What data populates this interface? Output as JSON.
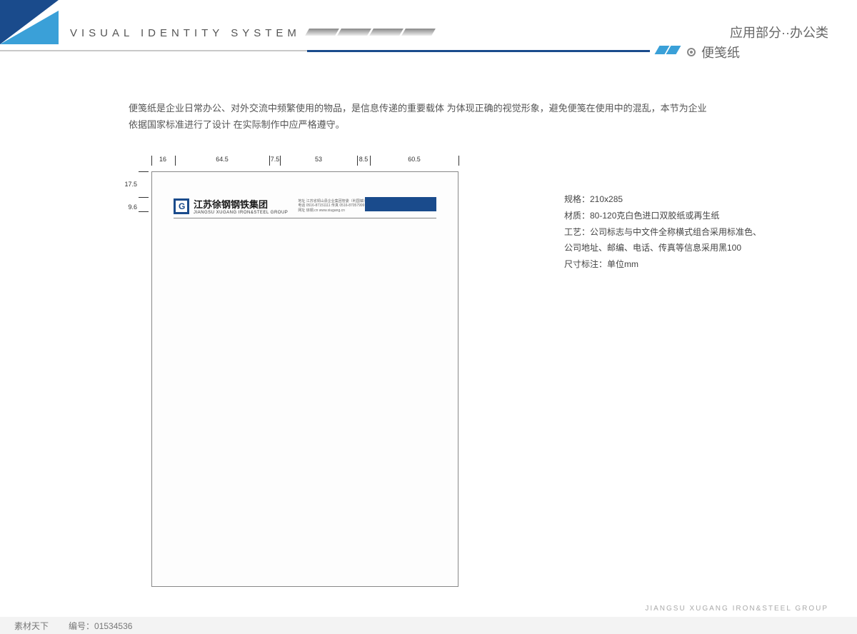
{
  "header": {
    "vis_title": "VISUAL IDENTITY SYSTEM",
    "section_label": "应用部分··办公类",
    "subsection_label": "便笺纸"
  },
  "intro": {
    "text": "便笺纸是企业日常办公、对外交流中频繁使用的物品，是信息传递的重要载体 为体现正确的视觉形象，避免便笺在使用中的混乱，本节为企业依据国家标准进行了设计 在实际制作中应严格遵守。"
  },
  "dimensions": {
    "horizontal": [
      "16",
      "64.5",
      "7.5",
      "53",
      "8.5",
      "60.5"
    ],
    "vertical": [
      "17.5",
      "9.6"
    ]
  },
  "letterhead": {
    "company_zh": "江苏徐钢钢铁集团",
    "company_en": "JIANGSU XUGANG IRON&STEEL GROUP",
    "info_line1": "地址 江苏省铜山县企业集团管委（利国镇）",
    "info_line2": "电话 0516-87151111  传真 0516-87057999",
    "info_line3": "网址  徐钢.cn  www.xiugang.cn"
  },
  "specs": {
    "line1": "规格：210x285",
    "line2": "材质：80-120克白色进口双胶纸或再生纸",
    "line3": "工艺：公司标志与中文件全称横式组合采用标准色、",
    "line4": "公司地址、邮编、电话、传真等信息采用黑100",
    "line5": "尺寸标注：单位mm"
  },
  "footer": {
    "company_en": "JIANGSU XUGANG IRON&STEEL GROUP"
  },
  "meta": {
    "source": "素材天下",
    "id_label": "编号：",
    "id_value": "01534536"
  }
}
